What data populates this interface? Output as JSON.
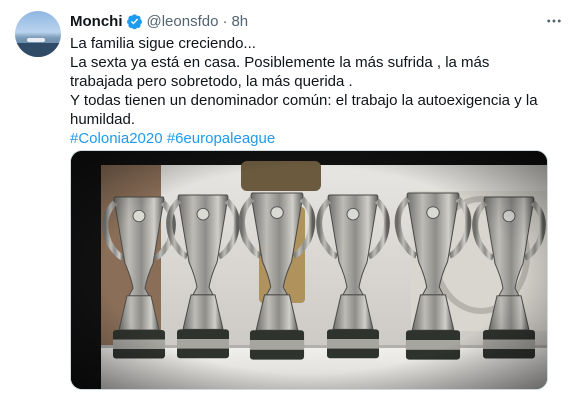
{
  "tweet": {
    "author_name": "Monchi",
    "handle": "@leonsfdo",
    "separator": "·",
    "time": "8h",
    "lines": [
      "La familia sigue creciendo...",
      "La sexta ya está en casa. Posiblemente  la más sufrida , la más trabajada pero sobretodo, la más querida .",
      "Y todas tienen un denominador común: el trabajo  la autoexigencia y la humildad."
    ],
    "hashtags": [
      "#Colonia2020",
      "#6europaleague"
    ],
    "icons": {
      "verified": "verified-badge-icon",
      "more": "more-options-icon"
    },
    "colors": {
      "link": "#1d9bf0",
      "verified": "#1d9bf0",
      "secondary_text": "#536471"
    }
  }
}
